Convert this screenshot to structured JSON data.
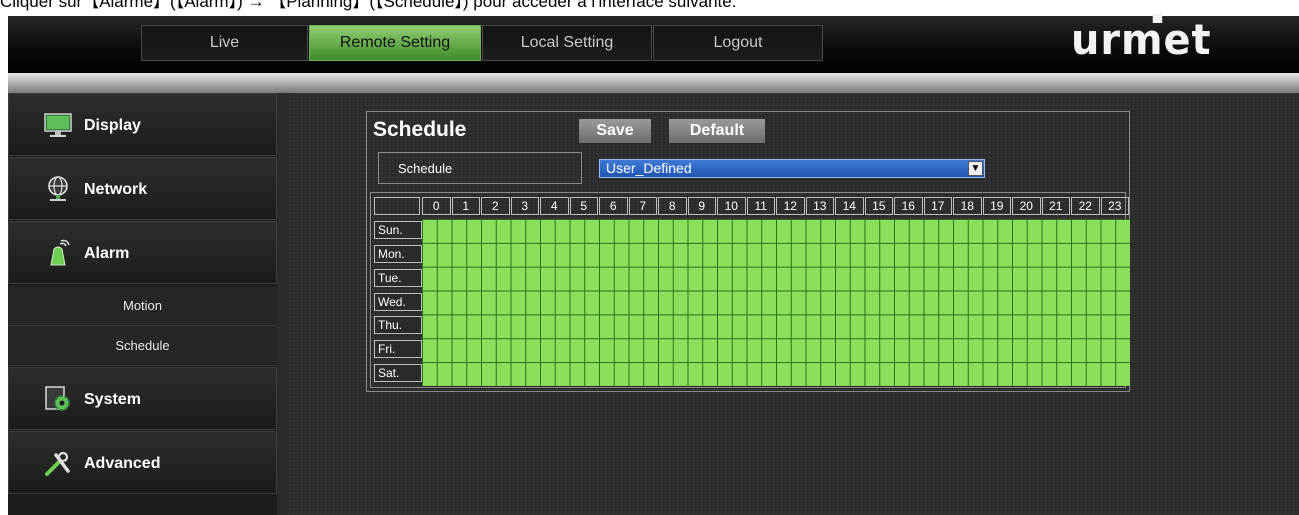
{
  "caption": "Cliquer sur【Alarme】(【Alarm】) → 【Planning】(【Schedule】) pour accéder à l'interface suivante.",
  "nav": {
    "tabs": [
      {
        "label": "Live"
      },
      {
        "label": "Remote Setting"
      },
      {
        "label": "Local Setting"
      },
      {
        "label": "Logout"
      }
    ],
    "active_tab": "Remote Setting",
    "logo": "urmet"
  },
  "sidebar": {
    "items": [
      {
        "label": "Display",
        "icon": "monitor-icon"
      },
      {
        "label": "Network",
        "icon": "network-globe-icon"
      },
      {
        "label": "Alarm",
        "icon": "alarm-siren-icon"
      },
      {
        "label": "Motion",
        "icon": null
      },
      {
        "label": "Schedule",
        "icon": null
      },
      {
        "label": "System",
        "icon": "system-gear-icon"
      },
      {
        "label": "Advanced",
        "icon": "tools-icon"
      }
    ]
  },
  "panel": {
    "title": "Schedule",
    "save_label": "Save",
    "default_label": "Default",
    "schedule_label": "Schedule",
    "schedule_value": "User_Defined",
    "hours": [
      "0",
      "1",
      "2",
      "3",
      "4",
      "5",
      "6",
      "7",
      "8",
      "9",
      "10",
      "11",
      "12",
      "13",
      "14",
      "15",
      "16",
      "17",
      "18",
      "19",
      "20",
      "21",
      "22",
      "23"
    ],
    "days": [
      "Sun.",
      "Mon.",
      "Tue.",
      "Wed.",
      "Thu.",
      "Fri.",
      "Sat."
    ],
    "all_slots_enabled": true,
    "enabled_color": "#8ae05a"
  }
}
